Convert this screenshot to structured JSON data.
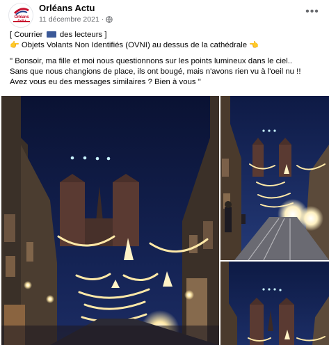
{
  "post": {
    "author": "Orléans Actu",
    "date": "11 décembre 2021",
    "separator": "·",
    "more_label": "•••",
    "avatar_word": "Orléans Actu",
    "text": {
      "line1_a": "[  Courrier",
      "line1_b": "des lecteurs  ]",
      "line2_hand": "👉",
      "line2_text": " Objets Volants Non Identifiés (OVNI) au dessus de la cathédrale ",
      "line2_hand_end": "👈",
      "line3": "\" Bonsoir, ma fille et moi nous questionnons sur les points lumineux dans le ciel..",
      "line4": "Sans que nous changions de place, ils ont bougé, mais n'avons rien vu à l'oeil nu !!",
      "line5": "Avez vous eu des messages similaires ? Bien à vous \""
    },
    "icons": {
      "globe": "globe-icon",
      "more": "more-options-icon",
      "flag": "mailbox-icon"
    }
  },
  "colors": {
    "meta_text": "#65676b",
    "sky_main": "#0f1a45",
    "light_warm": "#ffe9a8",
    "brand_red": "#c8102e"
  }
}
